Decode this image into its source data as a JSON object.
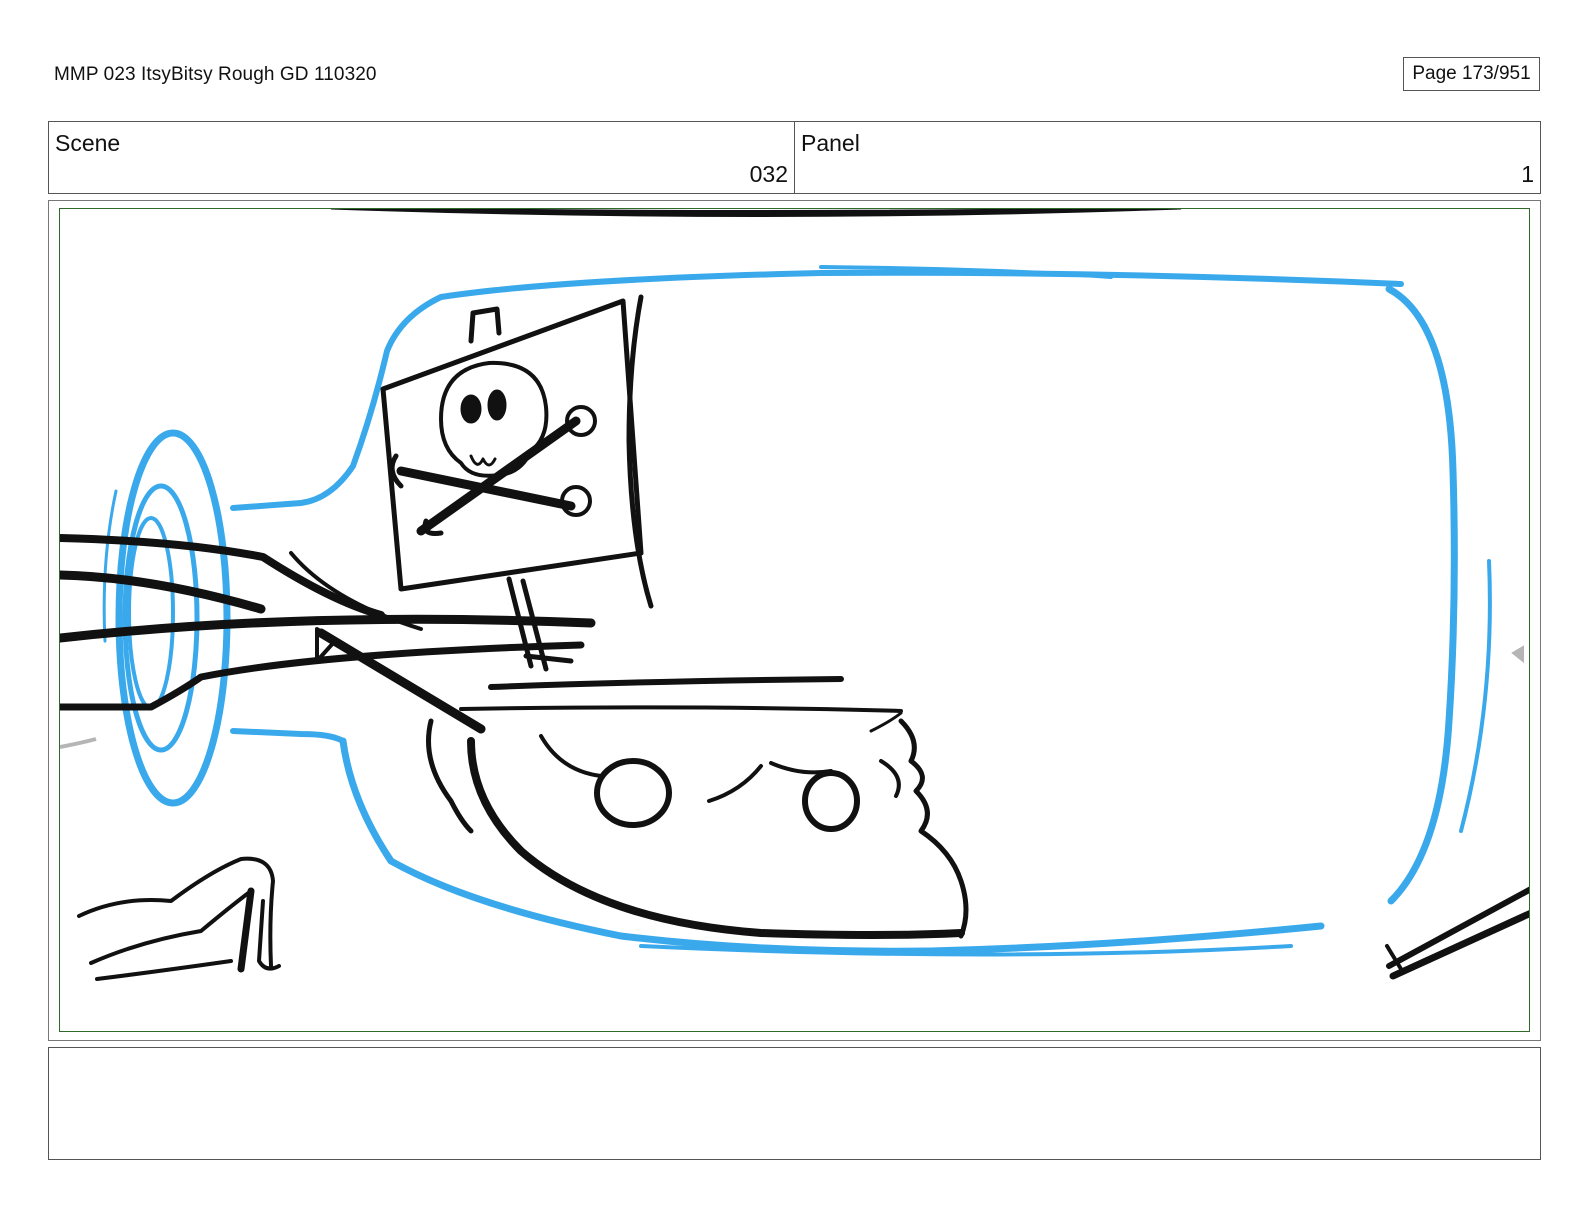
{
  "header": {
    "title": "MMP 023 ItsyBitsy Rough GD 110320",
    "page_label": "Page 173/951"
  },
  "scene": {
    "label": "Scene",
    "value": "032"
  },
  "panel": {
    "label": "Panel",
    "value": "1"
  },
  "drawing": {
    "bottle_color": "#3aa9ec",
    "ink_color": "#111111",
    "frame_color": "#2e6b2a"
  },
  "notes": {
    "text": ""
  }
}
